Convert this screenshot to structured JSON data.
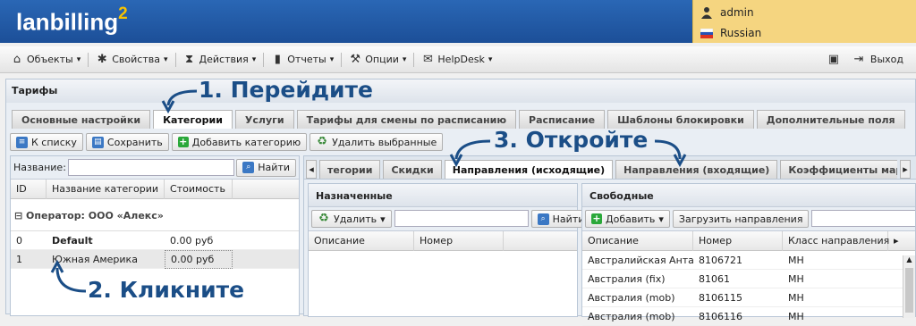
{
  "brand": {
    "name": "lanbilling",
    "version": "2"
  },
  "user": {
    "name": "admin",
    "language": "Russian"
  },
  "menu": [
    {
      "label": "Объекты",
      "icon": "objects-icon",
      "dropdown": true
    },
    {
      "label": "Свойства",
      "icon": "gear-icon",
      "dropdown": true
    },
    {
      "label": "Действия",
      "icon": "hourglass-icon",
      "dropdown": true
    },
    {
      "label": "Отчеты",
      "icon": "chart-icon",
      "dropdown": true
    },
    {
      "label": "Опции",
      "icon": "wrench-icon",
      "dropdown": true
    },
    {
      "label": "HelpDesk",
      "icon": "chat-icon",
      "dropdown": true
    }
  ],
  "logout": "Выход",
  "page": {
    "title": "Тарифы"
  },
  "tabs": [
    "Основные настройки",
    "Категории",
    "Услуги",
    "Тарифы для смены по расписанию",
    "Расписание",
    "Шаблоны блокировки",
    "Дополнительные поля"
  ],
  "toolbar": {
    "back": "К списку",
    "save": "Сохранить",
    "add": "Добавить категорию",
    "delete": "Удалить выбранные"
  },
  "left": {
    "filter_label": "Название:",
    "search": "Найти",
    "columns": [
      "ID",
      "Название категории",
      "Стоимость"
    ],
    "group": "Оператор: ООО «Алекс»",
    "rows": [
      [
        "0",
        "Default",
        "0.00 руб"
      ],
      [
        "1",
        "Южная Америка",
        "0.00 руб"
      ]
    ]
  },
  "subtabs": [
    "тегории",
    "Скидки",
    "Направления (исходящие)",
    "Направления (входящие)",
    "Коэффициенты маршрутов"
  ],
  "assigned": {
    "title": "Назначенные",
    "delete": "Удалить",
    "search": "Найти",
    "columns": [
      "Описание",
      "Номер"
    ]
  },
  "free": {
    "title": "Свободные",
    "add": "Добавить",
    "load": "Загрузить направления",
    "columns": [
      "Описание",
      "Номер",
      "Класс направления"
    ],
    "rows": [
      [
        "Австралийская Анта...",
        "8106721",
        "MH"
      ],
      [
        "Австралия (fix)",
        "81061",
        "MH"
      ],
      [
        "Австралия (mob)",
        "8106115",
        "MH"
      ],
      [
        "Австралия (mob)",
        "8106116",
        "MH"
      ]
    ]
  },
  "annotations": {
    "step1": "1. Перейдите",
    "step2": "2. Кликните",
    "step3": "3. Откройте"
  },
  "colors": {
    "header_blue": "#1c4f98",
    "accent_yellow": "#f7c200",
    "annotation": "#1b4e87"
  }
}
